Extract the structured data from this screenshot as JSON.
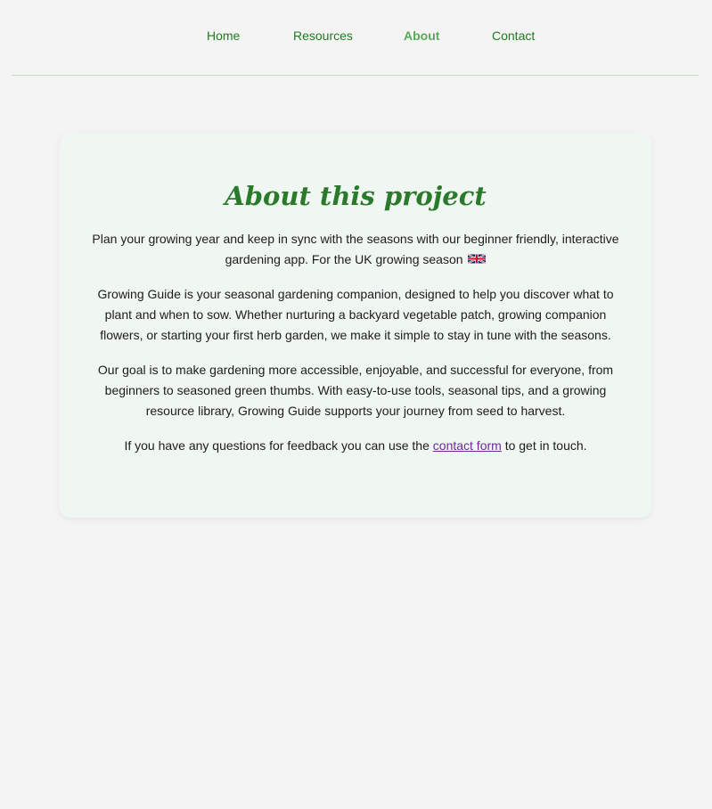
{
  "nav": {
    "items": [
      {
        "label": "Home",
        "active": false
      },
      {
        "label": "Resources",
        "active": false
      },
      {
        "label": "About",
        "active": true
      },
      {
        "label": "Contact",
        "active": false
      }
    ]
  },
  "colors": {
    "nav_link": "#1f7a1f",
    "nav_active": "#58a95a",
    "heading": "#2b7a2b",
    "card_bg": "#f0f6f1",
    "page_bg": "#f4f4f4",
    "link_visited": "#6a2a9a"
  },
  "main": {
    "title": "About this project",
    "intro": "Plan your growing year and keep in sync with the seasons with our beginner friendly, interactive gardening app. For the UK growing season",
    "intro_flag_icon": "uk-flag-icon",
    "paragraph2": "Growing Guide is your seasonal gardening companion, designed to help you discover what to plant and when to sow. Whether nurturing a backyard vegetable patch, growing companion flowers, or starting your first herb garden, we make it simple to stay in tune with the seasons.",
    "paragraph3": "Our goal is to make gardening more accessible, enjoyable, and successful for everyone, from beginners to seasoned green thumbs. With easy-to-use tools, seasonal tips, and a growing resource library, Growing Guide supports your journey from seed to harvest.",
    "contact_before": "If you have any questions for feedback you can use the",
    "contact_link": "contact form",
    "contact_after": "to get in touch."
  }
}
